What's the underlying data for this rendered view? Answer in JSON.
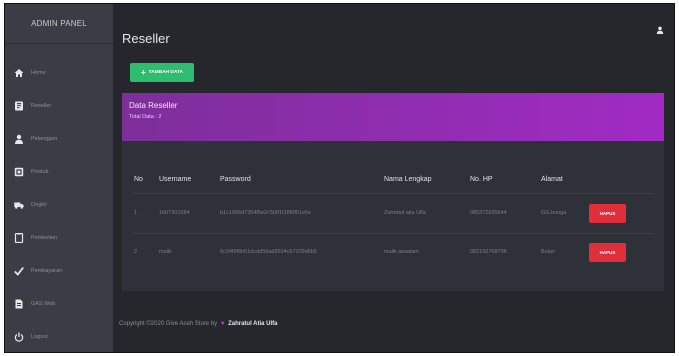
{
  "sidebar": {
    "brand": "ADMIN PANEL",
    "items": [
      {
        "label": "Home",
        "icon": "home-icon"
      },
      {
        "label": "Reseller",
        "icon": "id-card-icon"
      },
      {
        "label": "Pelanggan",
        "icon": "user-icon"
      },
      {
        "label": "Produk",
        "icon": "product-icon"
      },
      {
        "label": "Ongkir",
        "icon": "truck-icon"
      },
      {
        "label": "Pembelian",
        "icon": "document-icon"
      },
      {
        "label": "Pembayaran",
        "icon": "check-icon"
      },
      {
        "label": "GAS Web",
        "icon": "file-icon"
      },
      {
        "label": "Logout",
        "icon": "power-icon"
      }
    ]
  },
  "header": {
    "title": "Reseller",
    "user_icon": "user-icon"
  },
  "toolbar": {
    "add_label": "TAMBAH DATA",
    "add_icon": "plus-icon"
  },
  "card": {
    "title": "Data Reseller",
    "total": "Total Data : 2"
  },
  "table": {
    "headers": [
      "No",
      "Username",
      "Password",
      "Nama Lengkap",
      "No. HP",
      "Alamat"
    ],
    "rows": [
      {
        "no": "1",
        "username": "1667301084",
        "password": "b1c1656d7354f5e2c5081f18f6f51e5e",
        "nama": "Zahratul atia Ulfa",
        "hp": "085372635544",
        "alamat": "GG.bunga",
        "action": "HAPUS"
      },
      {
        "no": "2",
        "username": "malik",
        "password": "6c34f6f6b51dcdd56ad9204c67209d6b5",
        "nama": "malik assalam",
        "hp": "082156768796",
        "alamat": "Bulan",
        "action": "HAPUS"
      }
    ]
  },
  "footer": {
    "text": "Copyright ©2020 Give Aceh Store by",
    "heart": "♥",
    "author": "Zahratul Atia Ulfa"
  },
  "colors": {
    "sidebar": "#3a3d46",
    "background": "#25272d",
    "accent_green": "#2ebd6e",
    "accent_purple": "#8e2fb0",
    "danger_red": "#e02f3a"
  }
}
